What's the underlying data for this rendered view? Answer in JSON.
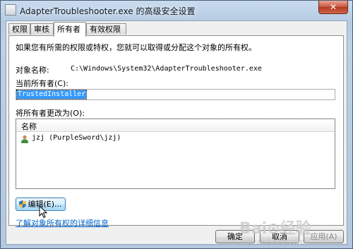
{
  "window": {
    "title": "AdapterTroubleshooter.exe 的高级安全设置",
    "close_symbol": "✕"
  },
  "tabs": [
    {
      "label": "权限",
      "active": false
    },
    {
      "label": "审核",
      "active": false
    },
    {
      "label": "所有者",
      "active": true
    },
    {
      "label": "有效权限",
      "active": false
    }
  ],
  "owner_tab": {
    "intro": "如果您有所需的权限或特权，您就可以取得或分配这个对象的所有权。",
    "object_name_label": "对象名称:",
    "object_name_value": "C:\\Windows\\System32\\AdapterTroubleshooter.exe",
    "current_owner_label": "当前所有者(C):",
    "current_owner_value": "TrustedInstaller",
    "change_owner_label": "将所有者更改为(O):",
    "list_column": "名称",
    "owners": [
      {
        "name": "jzj (PurpleSword\\jzj)",
        "icon": "user-icon"
      }
    ],
    "edit_button": "编辑(E)...",
    "learn_more_link": "了解对象所有权的详细信息"
  },
  "footer": {
    "ok": "确定",
    "cancel": "取消",
    "apply": "应用(A)"
  },
  "watermark": {
    "brand": "Bai⊙经验",
    "url": "jingyan.baidu.com"
  }
}
